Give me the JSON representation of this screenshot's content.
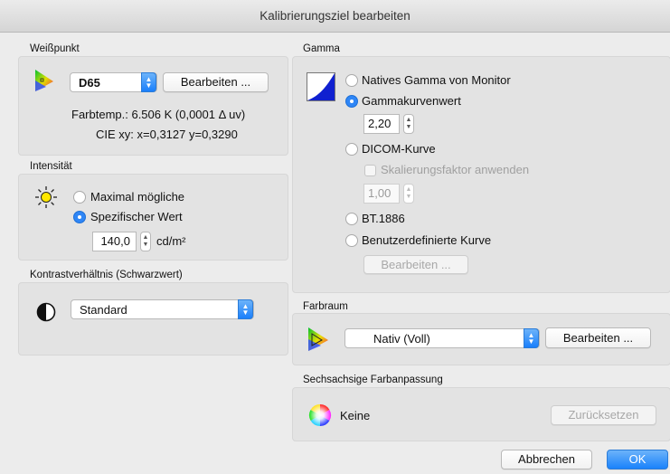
{
  "window": {
    "title": "Kalibrierungsziel bearbeiten"
  },
  "whitepoint": {
    "label": "Weißpunkt",
    "preset": "D65",
    "edit_button": "Bearbeiten ...",
    "colortemp": "Farbtemp.: 6.506 K (0,0001 Δ uv)",
    "cie": "CIE xy:  x=0,3127 y=0,3290"
  },
  "intensity": {
    "label": "Intensität",
    "option_max": "Maximal mögliche",
    "option_specific": "Spezifischer Wert",
    "value": "140,0",
    "unit": "cd/m²",
    "selected": "specific"
  },
  "contrast": {
    "label": "Kontrastverhältnis (Schwarzwert)",
    "value": "Standard"
  },
  "gamma": {
    "label": "Gamma",
    "option_native": "Natives Gamma von Monitor",
    "option_curve": "Gammakurvenwert",
    "curve_value": "2,20",
    "option_dicom": "DICOM-Kurve",
    "scaling_checkbox": "Skalierungsfaktor anwenden",
    "scaling_value": "1,00",
    "option_bt1886": "BT.1886",
    "option_custom": "Benutzerdefinierte Kurve",
    "custom_edit_button": "Bearbeiten ...",
    "selected": "curve"
  },
  "colorspace": {
    "label": "Farbraum",
    "value": "Nativ (Voll)",
    "edit_button": "Bearbeiten ..."
  },
  "sixaxis": {
    "label": "Sechsachsige Farbanpassung",
    "value": "Keine",
    "reset_button": "Zurücksetzen"
  },
  "footer": {
    "cancel": "Abbrechen",
    "ok": "OK"
  },
  "colors": {
    "accent": "#2f86f6",
    "window_bg": "#ececec",
    "group_bg": "#e3e3e3"
  }
}
